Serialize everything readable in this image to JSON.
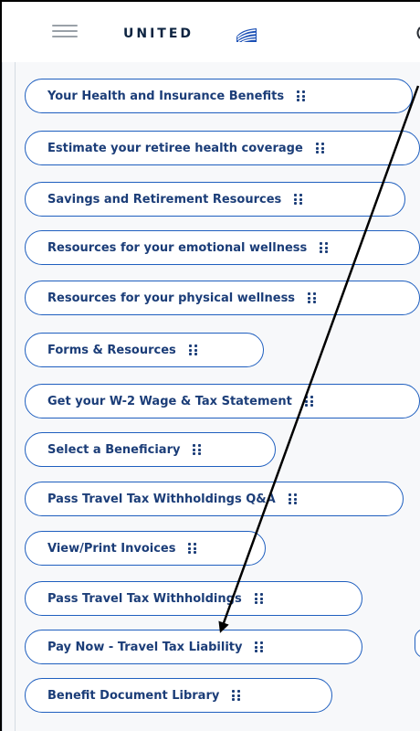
{
  "header": {
    "brand_text": "UNITED",
    "menu_icon": "hamburger-menu-icon",
    "brand_icon": "united-globe-icon",
    "brand_color": "#0c2340"
  },
  "links": [
    {
      "label": "Your Health and Insurance Benefits"
    },
    {
      "label": "Estimate your retiree health coverage"
    },
    {
      "label": "Savings and Retirement Resources"
    },
    {
      "label": "Resources for your emotional wellness"
    },
    {
      "label": "Resources for your physical wellness"
    },
    {
      "label": "Forms & Resources"
    },
    {
      "label": "Get your W-2 Wage & Tax Statement"
    },
    {
      "label": "Select a Beneficiary"
    },
    {
      "label": "Pass Travel Tax Withholdings Q&A"
    },
    {
      "label": "View/Print Invoices"
    },
    {
      "label": "Pass Travel Tax Withholdings"
    },
    {
      "label": "Pay Now - Travel Tax Liability"
    },
    {
      "label": "Benefit Document Library"
    }
  ],
  "drag_icon": "drag-handle-icon",
  "annotation": {
    "type": "arrow",
    "target": "Pay Now - Travel Tax Liability",
    "color": "#000000"
  },
  "colors": {
    "link_border": "#1f5fbf",
    "link_text": "#1b3d78",
    "background": "#f7f8fa"
  }
}
